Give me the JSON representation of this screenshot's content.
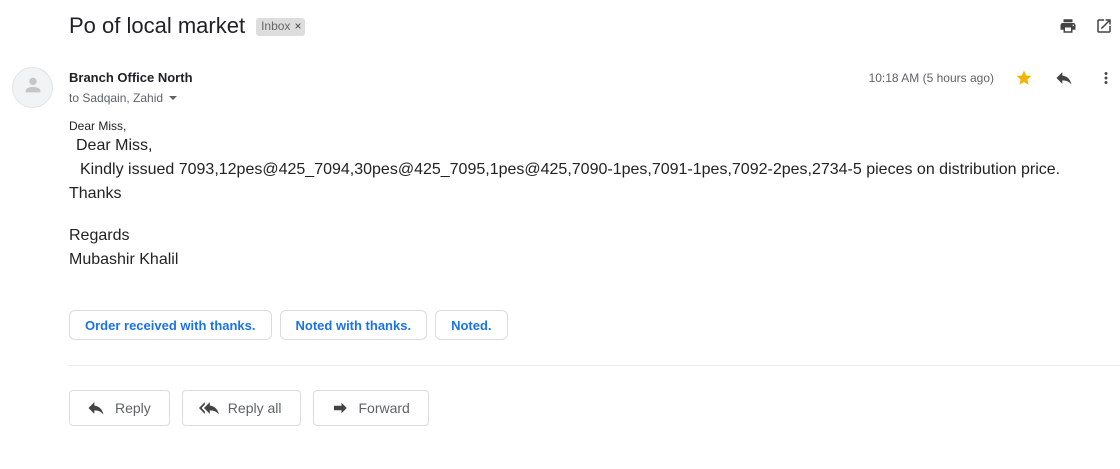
{
  "email": {
    "subject": "Po of local market",
    "label": "Inbox",
    "label_close": "×",
    "sender": "Branch Office North",
    "recipients": "to Sadqain, Zahid",
    "timestamp": "10:18 AM (5 hours ago)",
    "starred": true,
    "body": {
      "greeting_small": "Dear Miss,",
      "line1": "Dear Miss,",
      "line2": "Kindly issued 7093,12pes@425_7094,30pes@425_7095,1pes@425,7090-1pes,7091-1pes,7092-2pes,2734-5 pieces on distribution price.",
      "line3": "Thanks",
      "regards": "Regards",
      "signature": "Mubashir Khalil"
    }
  },
  "smart_replies": [
    "Order received with thanks.",
    "Noted with thanks.",
    "Noted."
  ],
  "actions": {
    "reply": "Reply",
    "reply_all": "Reply all",
    "forward": "Forward"
  },
  "icons": {
    "print": "print-icon",
    "open_new_window": "open-in-new-window-icon",
    "avatar": "person-icon",
    "star": "star-icon",
    "reply": "reply-icon",
    "more": "more-vert-icon",
    "reply_all": "reply-all-icon",
    "forward": "forward-icon"
  },
  "colors": {
    "star": "#f4b400",
    "link_blue": "#1a73e8",
    "label_bg": "#dddddd"
  }
}
